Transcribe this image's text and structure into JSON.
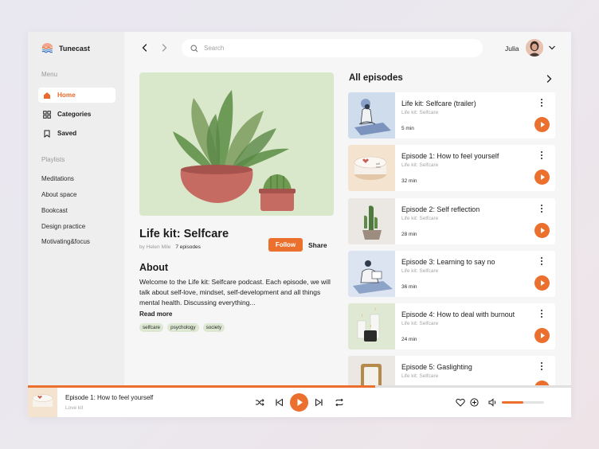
{
  "app": {
    "name": "Tunecast"
  },
  "colors": {
    "accent": "#eb6f2d",
    "hero_bg": "#d9e7ca",
    "tag_bg": "#dde8d3"
  },
  "sidebar": {
    "menu_label": "Menu",
    "menu": [
      {
        "label": "Home",
        "icon": "home-icon",
        "active": true
      },
      {
        "label": "Categories",
        "icon": "grid-icon",
        "active": false
      },
      {
        "label": "Saved",
        "icon": "bookmark-icon",
        "active": false
      }
    ],
    "playlists_label": "Playlists",
    "playlists": [
      "Meditations",
      "About space",
      "Bookcast",
      "Design practice",
      "Motivating&focus"
    ]
  },
  "header": {
    "search_placeholder": "Search",
    "user_name": "Julia"
  },
  "podcast": {
    "title": "Life kit: Selfcare",
    "author": "by Helen Mile",
    "episodes_count": "7 episodes",
    "follow_label": "Follow",
    "share_label": "Share",
    "about_heading": "About",
    "about_text": "Welcome to the Life kit: Selfcare podcast. Each episode, we will talk about self-love, mindset, self-development and all things mental health. Discussing everything...",
    "read_more": "Read more",
    "tags": [
      "selfcare",
      "psychology",
      "society"
    ]
  },
  "episodes": {
    "heading": "All episodes",
    "items": [
      {
        "title": "Life kit: Selfcare (trailer)",
        "show": "Life kit: Selfcare",
        "duration": "5 min",
        "thumb": "meditation-person-icon"
      },
      {
        "title": "Episode 1: How to feel yourself",
        "show": "Life kit: Selfcare",
        "duration": "32 min",
        "thumb": "box-icon"
      },
      {
        "title": "Episode 2: Self reflection",
        "show": "Life kit: Selfcare",
        "duration": "28 min",
        "thumb": "cactus-icon"
      },
      {
        "title": "Episode 3: Learning to say no",
        "show": "Life kit: Selfcare",
        "duration": "36 min",
        "thumb": "reading-person-icon"
      },
      {
        "title": "Episode 4: How to deal with burnout",
        "show": "Life kit: Selfcare",
        "duration": "24 min",
        "thumb": "candles-icon"
      },
      {
        "title": "Episode 5: Gaslighting",
        "show": "Life kit: Selfcare",
        "duration": "",
        "thumb": "mirror-icon"
      }
    ]
  },
  "player": {
    "title": "Episode 1: How to feel yourself",
    "subtitle": "Love kit",
    "progress": 0.64,
    "volume": 0.5
  }
}
